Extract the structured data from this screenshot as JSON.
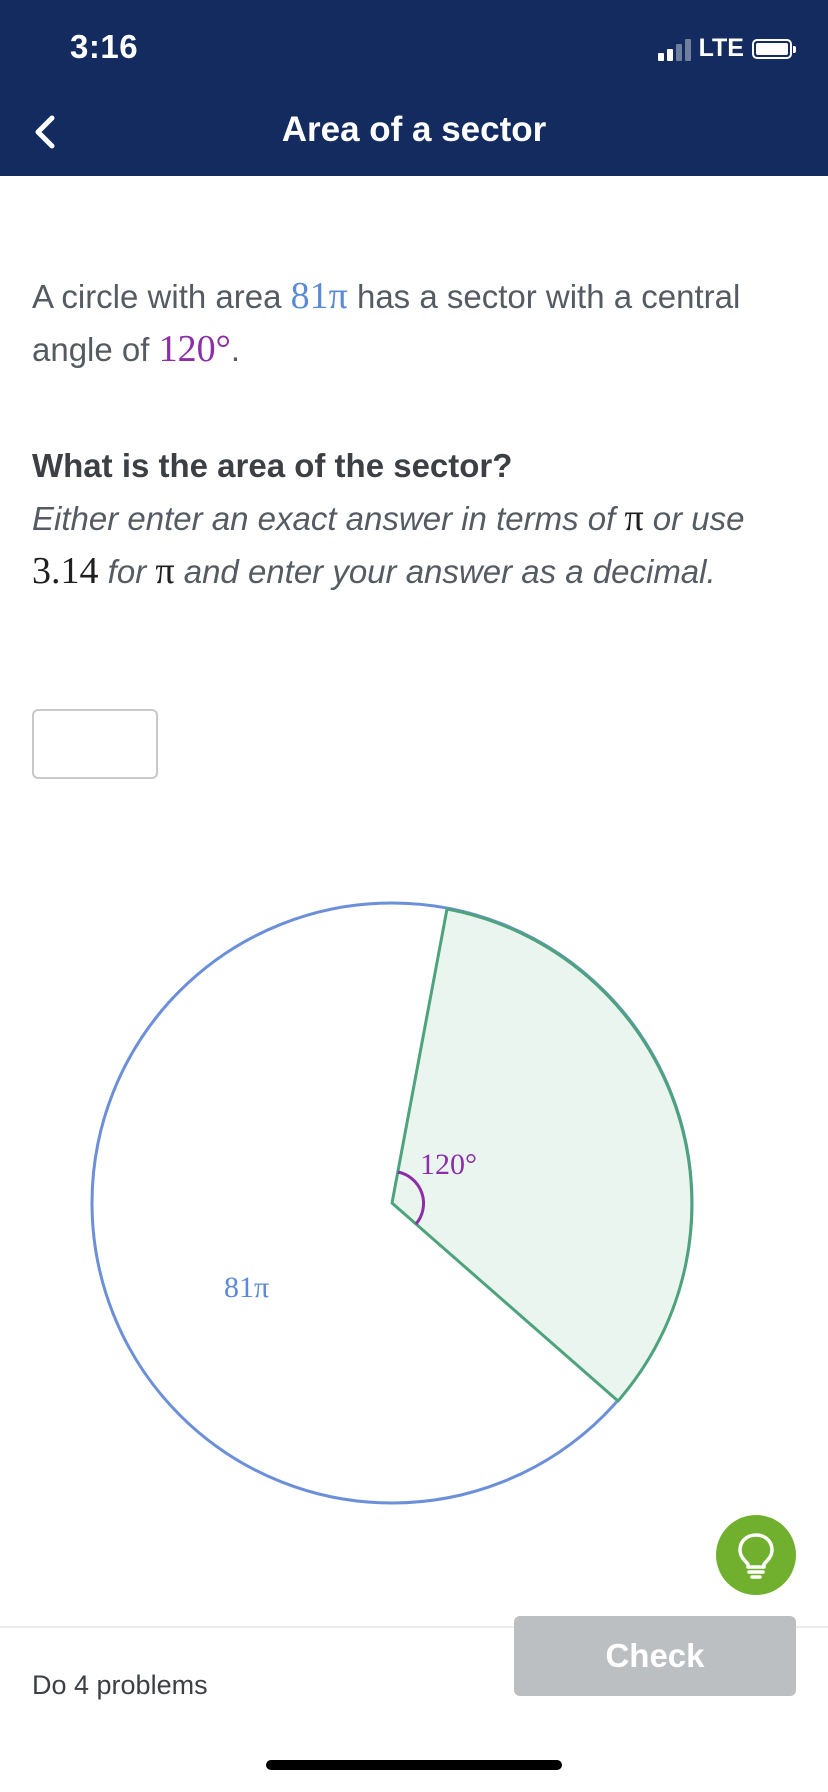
{
  "status_bar": {
    "time": "3:16",
    "network": "LTE"
  },
  "header": {
    "title": "Area of a sector"
  },
  "problem": {
    "text_1": "A circle with area ",
    "area": "81π",
    "text_2": " has a sector with a central angle of ",
    "angle": "120°",
    "text_3": "."
  },
  "question": {
    "title": "What is the area of the sector?",
    "inst_1": "Either enter an exact answer in terms of ",
    "pi_1": "π",
    "inst_2": " or use ",
    "approx": "3.14",
    "inst_3": " for ",
    "pi_2": "π",
    "inst_4": " and enter your answer as a decimal."
  },
  "answer": {
    "value": ""
  },
  "diagram": {
    "circle_label": "81π",
    "angle_label": "120°",
    "central_angle_deg": 120,
    "colors": {
      "circle": "#6b8fd8",
      "sector": "#4da37b",
      "sector_fill": "#eaf5ef",
      "angle": "#8c2ea8",
      "area_label": "#5c8bd6"
    }
  },
  "footer": {
    "progress": "Do 4 problems",
    "check_label": "Check"
  },
  "icons": {
    "back": "chevron-left-icon",
    "hint": "lightbulb-icon",
    "battery": "battery-icon",
    "signal": "signal-icon"
  }
}
